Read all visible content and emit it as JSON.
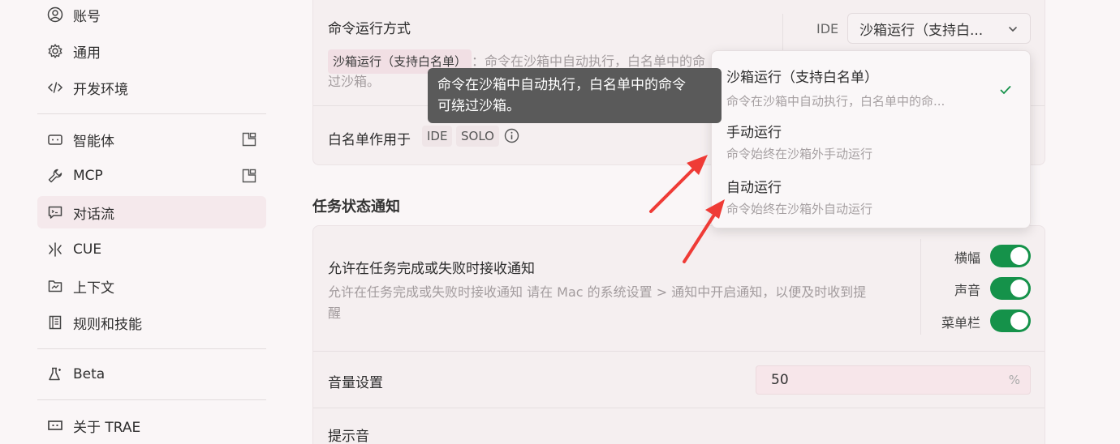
{
  "sidebar": {
    "items": [
      {
        "label": "账号",
        "icon": "user-icon"
      },
      {
        "label": "通用",
        "icon": "gear-icon"
      },
      {
        "label": "开发环境",
        "icon": "code-icon"
      },
      {
        "label": "智能体",
        "icon": "bot-icon"
      },
      {
        "label": "MCP",
        "icon": "wrench-icon"
      },
      {
        "label": "对话流",
        "icon": "chat-icon"
      },
      {
        "label": "CUE",
        "icon": "cue-icon"
      },
      {
        "label": "上下文",
        "icon": "folder-icon"
      },
      {
        "label": "规则和技能",
        "icon": "book-icon"
      },
      {
        "label": "Beta",
        "icon": "flask-icon"
      },
      {
        "label": "关于 TRAE",
        "icon": "trae-icon"
      }
    ]
  },
  "command": {
    "title": "命令运行方式",
    "desc_chip": "沙箱运行（支持白名单）",
    "desc_text_1": "：命令在沙箱中自动执行，白名单中的命",
    "desc_text_2": "过沙箱。",
    "ide_label": "IDE",
    "select_value": "沙箱运行（支持白...",
    "whitelist_title": "白名单作用于",
    "tag_ide": "IDE",
    "tag_solo": "SOLO"
  },
  "tooltip": {
    "line1": "命令在沙箱中自动执行，白名单中的命令",
    "line2": "可绕过沙箱。"
  },
  "dropdown": {
    "options": [
      {
        "title": "沙箱运行（支持白名单）",
        "desc": "命令在沙箱中自动执行，白名单中的命...",
        "selected": true
      },
      {
        "title": "手动运行",
        "desc": "命令始终在沙箱外手动运行",
        "selected": false
      },
      {
        "title": "自动运行",
        "desc": "命令始终在沙箱外自动运行",
        "selected": false
      }
    ]
  },
  "notify": {
    "section_title": "任务状态通知",
    "title": "允许在任务完成或失败时接收通知",
    "desc_1": "允许在任务完成或失败时接收通知 请在 Mac 的系统设置 > 通知中开启通知，以便及时收到提",
    "desc_2": "醒",
    "toggles": [
      {
        "label": "横幅",
        "on": true
      },
      {
        "label": "声音",
        "on": true
      },
      {
        "label": "菜单栏",
        "on": true
      }
    ],
    "volume_label": "音量设置",
    "volume_value": "50",
    "volume_unit": "%",
    "sound_label": "提示音"
  },
  "colors": {
    "accent_green": "#15924a",
    "arrow_red": "#ef3b36",
    "active_bg": "#f5e9ec"
  }
}
